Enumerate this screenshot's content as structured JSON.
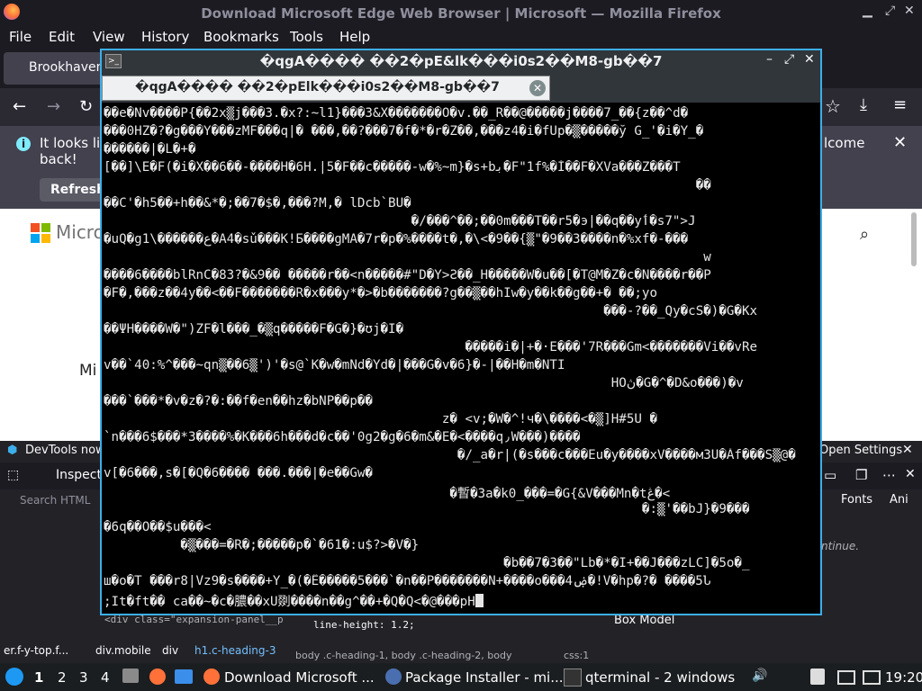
{
  "firefox": {
    "window_title": "Download Microsoft Edge Web Browser | Microsoft — Mozilla Firefox",
    "menu": [
      "File",
      "Edit",
      "View",
      "History",
      "Bookmarks",
      "Tools",
      "Help"
    ],
    "tab_label": "Brookhaven",
    "notification": {
      "text_line1": "It looks lik",
      "text_line2": "back!",
      "refresh_label": "Refresh",
      "welcome_fragment": "lcome"
    },
    "page": {
      "brand": "Microsoft",
      "mid_text": "Mi"
    },
    "devtools": {
      "banner": "DevTools now f",
      "open_settings": "Open Settings",
      "inspector": "Inspecto",
      "search_placeholder": "Search HTML",
      "fonts": "Fonts",
      "anim": "Ani",
      "continue_hint": "ntinue.",
      "box_model": "Box Model",
      "line_height": "line-height: 1.2;",
      "css_breadcrumb": "body .c-heading-1, body .c-heading-2, body",
      "css_source": "css:1",
      "html_breadcrumb": [
        "er.f-y-top.f...",
        "div.mobile",
        "div",
        "h1.c-heading-3"
      ],
      "html_snippet": "<div class=\"expansion-panel__p"
    }
  },
  "terminal": {
    "window_title": "�qgA���� ��2�pE&lk���i0s2��M8-gb��7",
    "tab_label": "�qgA���� ��2�pElk���i0s2��M8-gb��7",
    "lines": [
      "��e�Nv����P{��2x▒j���3.�x?:~l1}���3&X�������O�v.��_R��@�����j����7_��{z��^d�",
      "���0HZ�?�g���Y���zMF���q|� ���,��?���7�f�*�r�Z��,���z4�i�fUp�▒�����ў G_'�i�Y_�",
      "������|�L�+�",
      "[��]\\E�F(�i�X��6��-����H�6H.|5�F��c�����-w�%~m}�s+bﺑ�F\"1f%�Ǐ��F�XVa���Z���T",
      "                                                                             ��",
      "��C'�h5��+h��&*�;��7�$�,���?M,� lDcb`BU�",
      "                                        �/���^��;��0m���T��r5�э|��q��yٲ�s7\">J",
      "�uQ�g1\\������ع�A4�sǔ���K!Б����gMA�7r�p�%����t�,�\\<�9��{▒\"�9��3����n�%xf�-���",
      "                                                                              w",
      "����6����blRnC�83?�&9�� �����r��<n�����#\"D�Y>Ƨ��_H�����W�u��[�T@M�Z�c�N����r��P",
      "�F�,���z��4y��<��F�������R�x���y*�>�b�������?g��▒��hIw�y��k��g��+� ��;yo",
      "                                                                 ���-?��_Qy�cS�)�G�Kx",
      "��ΨH����W�\")ZF�l���_�▒q�����F�G�}�ʊj�I�",
      "                                               �����i�|+�·E���'7R���Gm<�������Vi��vRe",
      "v��`40:%^���~qn▒��6▒')'�s@`K�w�mNd�Yd�|���G�v�6}�-|��H�m�NTI",
      "                                                                  HOڽ�G�^�D&o���)�v",
      "���`���*�v�z�?�:��f�en��hz�bNP��p��",
      "                                            z� <v;�W�^!ч�\\����<�▒]H#5U �",
      "`n���6$���*3����%�K���6h���d�c��'0g2�g�6�m&�E�<����q٫W���)����",
      "                                              �/_a�r|(�s���c���Eu�y����xV����м3U�Ăf���S▒@�",
      "v[�6���,s�[�Q�6���� ���.���|�e��Gw�",
      "                                             �暫�3a�k0_���=�G{&V���Mn�tڠ�<",
      "                                                                      �:▒'��bJ}�9���",
      "�6q��O��$u���<",
      "          �▒���=�R�;�����p�`�61�:u$?>�V�}",
      "                                                    �b��7�3��\"Lb�*�I+��J���zLC]�5o�_",
      "ш�o�T ���r8|Vz9�s����+Y_�(�Ë�����5���`�n��P�������N+����o���4ۻ�!V�hp�?� ����5Ն",
      ";It�ft�� ca��~�c�膿��xU剟����n��g^��+�Q�Q<�@���pH"
    ]
  },
  "taskbar": {
    "workspaces": [
      "1",
      "2",
      "3",
      "4"
    ],
    "items": [
      "Download Microsoft ...",
      "Package Installer - mi...",
      "qterminal - 2 windows"
    ],
    "clock": "19:20"
  },
  "colors": {
    "accent": "#3daee9",
    "terminal_bg": "#000000",
    "firefox_bg": "#2b2a33"
  }
}
